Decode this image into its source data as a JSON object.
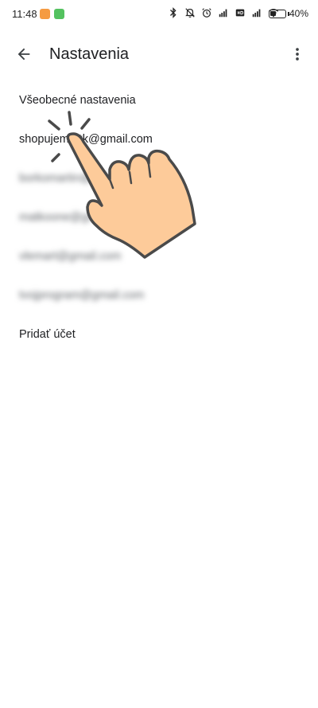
{
  "status_bar": {
    "time": "11:48",
    "battery_percent": "40",
    "battery_unit": "%",
    "battery_level": 0.4,
    "icons": [
      "bluetooth-icon",
      "bell-off-icon",
      "alarm-icon",
      "signal-icon",
      "hd-icon",
      "signal-icon",
      "wifi-icon",
      "battery-icon"
    ]
  },
  "app_bar": {
    "title": "Nastavenia",
    "back_icon": "arrow-back-icon",
    "menu_icon": "more-vert-icon"
  },
  "settings_list": {
    "items": [
      {
        "label": "Všeobecné nastavenia"
      },
      {
        "label": "shopujem***k@gmail.com"
      },
      {
        "label": "borkomartin@gmail.com"
      },
      {
        "label": "matkoone@gmail.com"
      },
      {
        "label": "vlemart@gmail.com"
      },
      {
        "label": "tvojprogram@gmail.com"
      },
      {
        "label": "Pridať účet"
      }
    ]
  },
  "overlay": {
    "icon": "tap-hand-icon",
    "colors": {
      "skin": "#FDCB9A",
      "outline": "#4A4A4A"
    }
  }
}
